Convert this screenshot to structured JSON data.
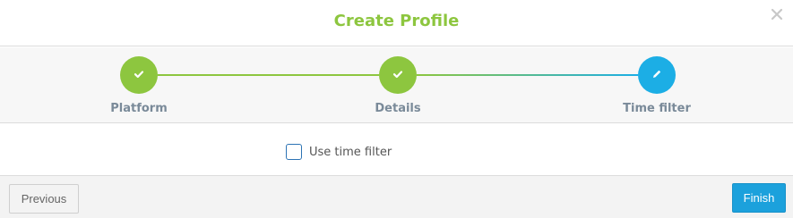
{
  "dialog": {
    "title": "Create Profile",
    "close_icon": "close-icon"
  },
  "stepper": {
    "steps": [
      {
        "label": "Platform",
        "state": "done",
        "icon": "check-icon"
      },
      {
        "label": "Details",
        "state": "done",
        "icon": "check-icon"
      },
      {
        "label": "Time filter",
        "state": "active",
        "icon": "pencil-icon"
      }
    ]
  },
  "form": {
    "time_filter_label": "Use time filter",
    "time_filter_checked": false
  },
  "footer": {
    "previous_label": "Previous",
    "finish_label": "Finish"
  },
  "colors": {
    "accent_green": "#8dc63f",
    "accent_blue": "#1caee5",
    "finish_button": "#1ca1dc"
  }
}
